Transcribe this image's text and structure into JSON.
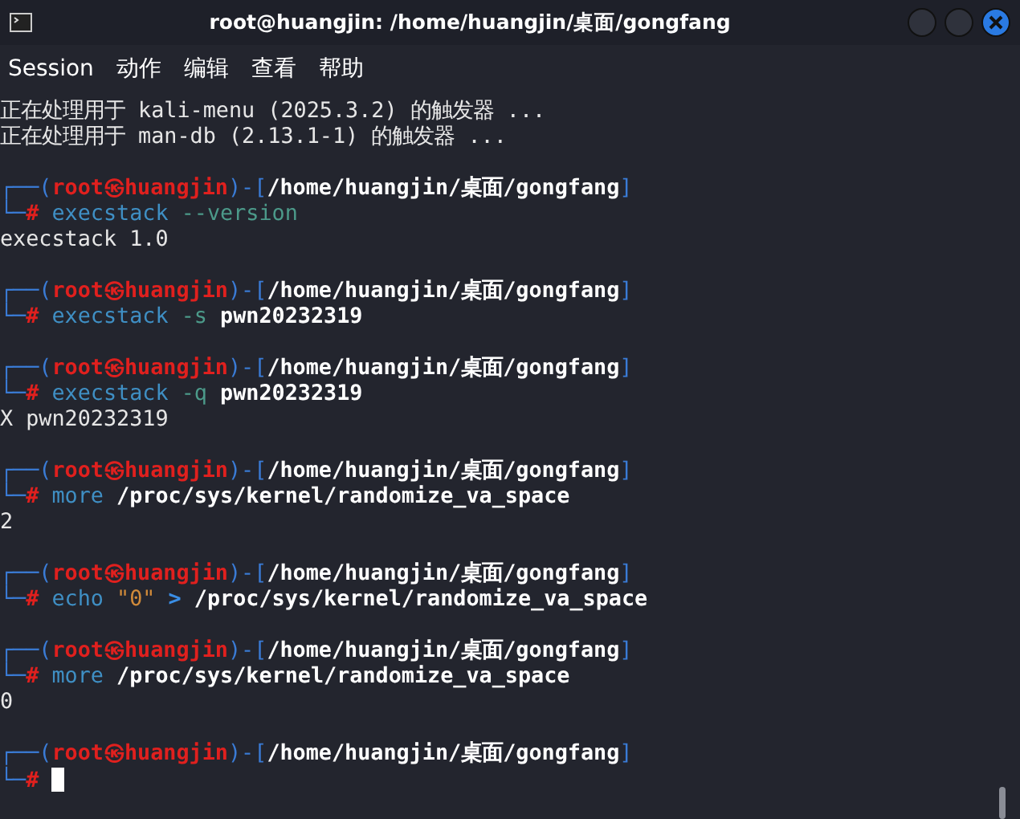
{
  "window": {
    "title": "root@huangjin: /home/huangjin/桌面/gongfang"
  },
  "menu": [
    "Session",
    "动作",
    "编辑",
    "查看",
    "帮助"
  ],
  "terminal": {
    "lines": [
      {
        "kind": "output",
        "segments": [
          {
            "kind": "plain",
            "text": "正在处理用于 kali-menu (2025.3.2) 的触发器 ..."
          }
        ]
      },
      {
        "kind": "output",
        "segments": [
          {
            "kind": "plain",
            "text": "正在处理用于 man-db (2.13.1-1) 的触发器 ..."
          }
        ]
      },
      {
        "kind": "blank"
      },
      {
        "kind": "prompt",
        "segments": [
          {
            "kind": "frame",
            "text": "┌──("
          },
          {
            "kind": "user",
            "text": "root㉿huangjin"
          },
          {
            "kind": "frame",
            "text": ")-["
          },
          {
            "kind": "path",
            "text": "/home/huangjin/桌面/gongfang"
          },
          {
            "kind": "frame",
            "text": "]"
          }
        ]
      },
      {
        "kind": "command",
        "segments": [
          {
            "kind": "frame",
            "text": "└─"
          },
          {
            "kind": "hash",
            "text": "#"
          },
          {
            "kind": "cmd",
            "text": " execstack"
          },
          {
            "kind": "opt",
            "text": " --version"
          }
        ]
      },
      {
        "kind": "output",
        "segments": [
          {
            "kind": "plain",
            "text": "execstack 1.0"
          }
        ]
      },
      {
        "kind": "blank"
      },
      {
        "kind": "prompt",
        "segments": [
          {
            "kind": "frame",
            "text": "┌──("
          },
          {
            "kind": "user",
            "text": "root㉿huangjin"
          },
          {
            "kind": "frame",
            "text": ")-["
          },
          {
            "kind": "path",
            "text": "/home/huangjin/桌面/gongfang"
          },
          {
            "kind": "frame",
            "text": "]"
          }
        ]
      },
      {
        "kind": "command",
        "segments": [
          {
            "kind": "frame",
            "text": "└─"
          },
          {
            "kind": "hash",
            "text": "#"
          },
          {
            "kind": "cmd",
            "text": " execstack"
          },
          {
            "kind": "opt",
            "text": " -s"
          },
          {
            "kind": "arg",
            "text": " pwn20232319"
          }
        ]
      },
      {
        "kind": "blank"
      },
      {
        "kind": "prompt",
        "segments": [
          {
            "kind": "frame",
            "text": "┌──("
          },
          {
            "kind": "user",
            "text": "root㉿huangjin"
          },
          {
            "kind": "frame",
            "text": ")-["
          },
          {
            "kind": "path",
            "text": "/home/huangjin/桌面/gongfang"
          },
          {
            "kind": "frame",
            "text": "]"
          }
        ]
      },
      {
        "kind": "command",
        "segments": [
          {
            "kind": "frame",
            "text": "└─"
          },
          {
            "kind": "hash",
            "text": "#"
          },
          {
            "kind": "cmd",
            "text": " execstack"
          },
          {
            "kind": "opt",
            "text": " -q"
          },
          {
            "kind": "arg",
            "text": " pwn20232319"
          }
        ]
      },
      {
        "kind": "output",
        "segments": [
          {
            "kind": "plain",
            "text": "X pwn20232319"
          }
        ]
      },
      {
        "kind": "blank"
      },
      {
        "kind": "prompt",
        "segments": [
          {
            "kind": "frame",
            "text": "┌──("
          },
          {
            "kind": "user",
            "text": "root㉿huangjin"
          },
          {
            "kind": "frame",
            "text": ")-["
          },
          {
            "kind": "path",
            "text": "/home/huangjin/桌面/gongfang"
          },
          {
            "kind": "frame",
            "text": "]"
          }
        ]
      },
      {
        "kind": "command",
        "segments": [
          {
            "kind": "frame",
            "text": "└─"
          },
          {
            "kind": "hash",
            "text": "#"
          },
          {
            "kind": "cmd",
            "text": " more"
          },
          {
            "kind": "arg",
            "text": " /proc/sys/kernel/randomize_va_space"
          }
        ]
      },
      {
        "kind": "output",
        "segments": [
          {
            "kind": "plain",
            "text": "2"
          }
        ]
      },
      {
        "kind": "blank"
      },
      {
        "kind": "prompt",
        "segments": [
          {
            "kind": "frame",
            "text": "┌──("
          },
          {
            "kind": "user",
            "text": "root㉿huangjin"
          },
          {
            "kind": "frame",
            "text": ")-["
          },
          {
            "kind": "path",
            "text": "/home/huangjin/桌面/gongfang"
          },
          {
            "kind": "frame",
            "text": "]"
          }
        ]
      },
      {
        "kind": "command",
        "segments": [
          {
            "kind": "frame",
            "text": "└─"
          },
          {
            "kind": "hash",
            "text": "#"
          },
          {
            "kind": "cmd",
            "text": " echo"
          },
          {
            "kind": "str",
            "text": " \"0\""
          },
          {
            "kind": "op",
            "text": " >"
          },
          {
            "kind": "arg",
            "text": " /proc/sys/kernel/randomize_va_space"
          }
        ]
      },
      {
        "kind": "blank"
      },
      {
        "kind": "prompt",
        "segments": [
          {
            "kind": "frame",
            "text": "┌──("
          },
          {
            "kind": "user",
            "text": "root㉿huangjin"
          },
          {
            "kind": "frame",
            "text": ")-["
          },
          {
            "kind": "path",
            "text": "/home/huangjin/桌面/gongfang"
          },
          {
            "kind": "frame",
            "text": "]"
          }
        ]
      },
      {
        "kind": "command",
        "segments": [
          {
            "kind": "frame",
            "text": "└─"
          },
          {
            "kind": "hash",
            "text": "#"
          },
          {
            "kind": "cmd",
            "text": " more"
          },
          {
            "kind": "arg",
            "text": " /proc/sys/kernel/randomize_va_space"
          }
        ]
      },
      {
        "kind": "output",
        "segments": [
          {
            "kind": "plain",
            "text": "0"
          }
        ]
      },
      {
        "kind": "blank"
      },
      {
        "kind": "prompt",
        "segments": [
          {
            "kind": "frame",
            "text": "┌──("
          },
          {
            "kind": "user",
            "text": "root㉿huangjin"
          },
          {
            "kind": "frame",
            "text": ")-["
          },
          {
            "kind": "path",
            "text": "/home/huangjin/桌面/gongfang"
          },
          {
            "kind": "frame",
            "text": "]"
          }
        ]
      },
      {
        "kind": "command",
        "segments": [
          {
            "kind": "frame",
            "text": "└─"
          },
          {
            "kind": "hash",
            "text": "#"
          },
          {
            "kind": "cursor"
          }
        ]
      }
    ]
  }
}
